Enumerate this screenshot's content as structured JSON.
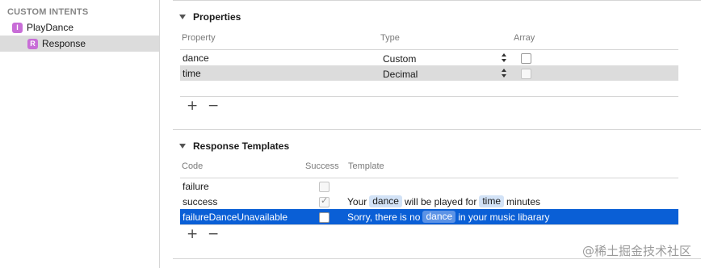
{
  "sidebar": {
    "header": "CUSTOM INTENTS",
    "items": [
      {
        "badge": "I",
        "label": "PlayDance"
      },
      {
        "badge": "R",
        "label": "Response"
      }
    ]
  },
  "properties": {
    "title": "Properties",
    "columns": {
      "property": "Property",
      "type": "Type",
      "array": "Array"
    },
    "rows": [
      {
        "name": "dance",
        "type": "Custom",
        "array": false
      },
      {
        "name": "time",
        "type": "Decimal",
        "array": false
      }
    ],
    "add_label": "+",
    "remove_label": "−"
  },
  "templates": {
    "title": "Response Templates",
    "columns": {
      "code": "Code",
      "success": "Success",
      "template": "Template"
    },
    "rows": [
      {
        "code": "failure",
        "success": false,
        "template": []
      },
      {
        "code": "success",
        "success": true,
        "template": [
          {
            "text": "Your"
          },
          {
            "token": "dance"
          },
          {
            "text": "will be played for"
          },
          {
            "token": "time"
          },
          {
            "text": "minutes"
          }
        ]
      },
      {
        "code": "failureDanceUnavailable",
        "success": false,
        "selected": true,
        "template": [
          {
            "text": "Sorry, there is no"
          },
          {
            "token": "dance"
          },
          {
            "text": "in your music libarary"
          }
        ]
      }
    ],
    "add_label": "+",
    "remove_label": "−"
  },
  "checkmark": "✓",
  "watermark": "@稀土掘金技术社区",
  "colors": {
    "selection": "#0a5fd6",
    "badge": "#c86dd7",
    "token": "#d2e2f6"
  }
}
